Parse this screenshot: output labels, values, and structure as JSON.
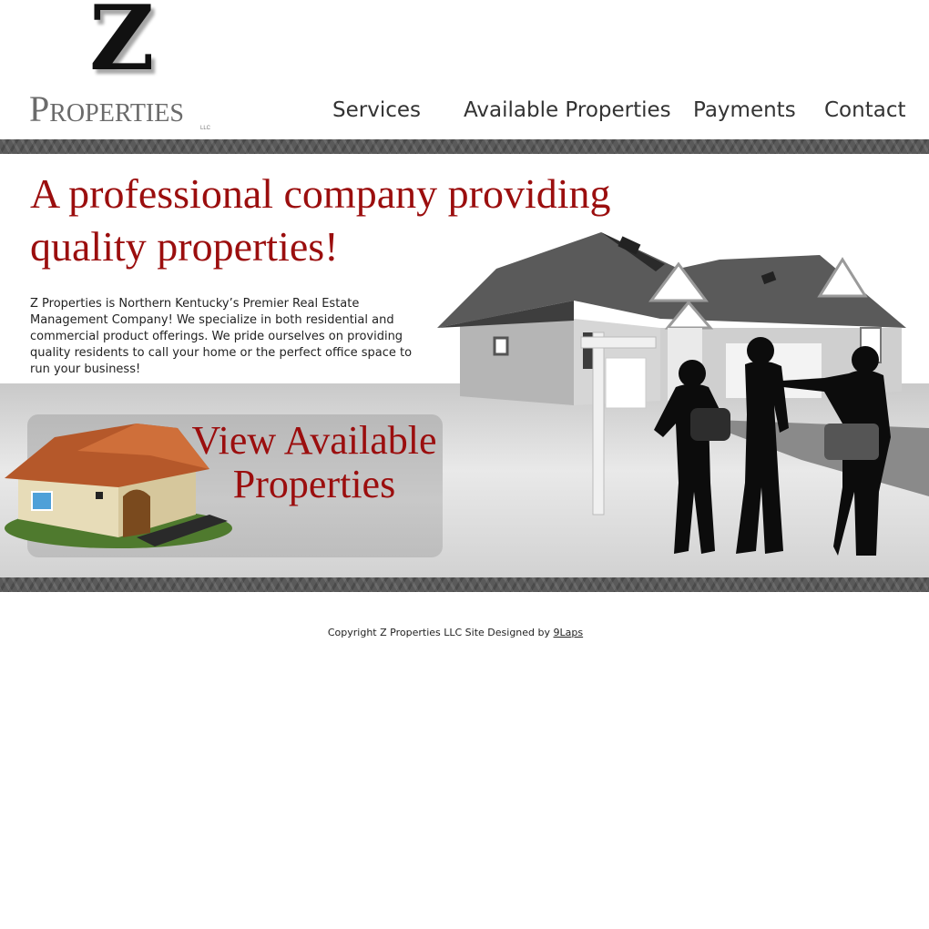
{
  "logo": {
    "letter": "Z",
    "word": "Properties",
    "suffix": "LLC"
  },
  "nav": {
    "services": "Services",
    "available": "Available Properties",
    "payments": "Payments",
    "contact": "Contact"
  },
  "hero": {
    "title_line1": "A professional company providing",
    "title_line2": "quality properties!",
    "intro": "Z Properties is Northern Kentucky’s Premier Real Estate Management Company! We specialize in both residential and commercial product offerings. We pride ourselves on providing quality residents to call your home or the perfect office space to run your business!"
  },
  "cta": {
    "line1": "View Available",
    "line2": "Properties"
  },
  "footer": {
    "copyright": "Copyright Z Properties LLC  Site Designed by",
    "designer_link": "9Laps"
  },
  "colors": {
    "accent_red": "#9b0e0e",
    "band_gray": "#5a5a5a",
    "text_dark": "#333333"
  },
  "icons": [
    "house-illustration",
    "people-silhouettes",
    "for-sale-sign",
    "cottage-illustration"
  ]
}
